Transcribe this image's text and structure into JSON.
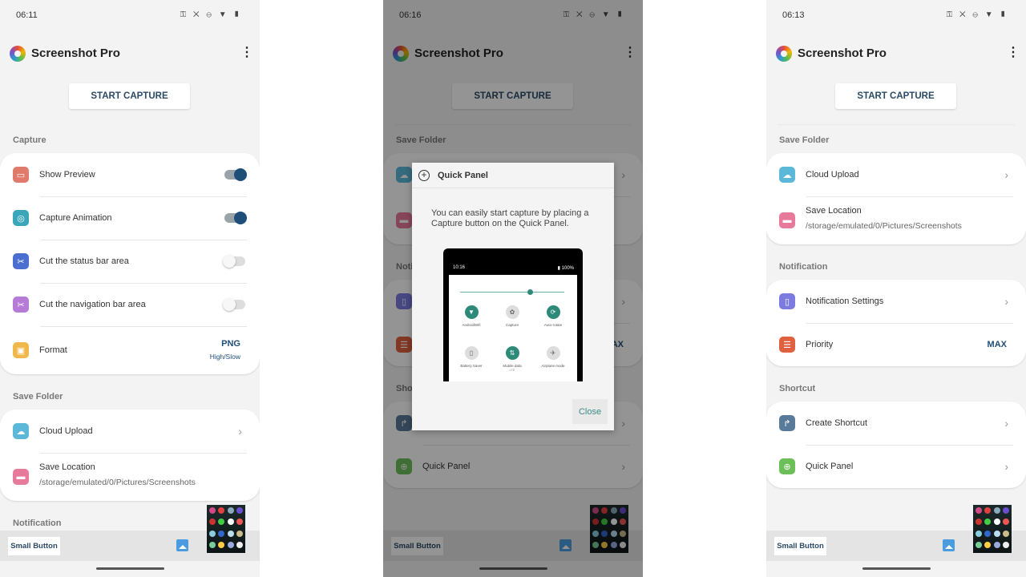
{
  "app": {
    "title": "Screenshot Pro",
    "start_capture": "START CAPTURE",
    "small_button": "Small Button",
    "status_icons": "⚿ ✕ ⊖ ▼ ▮"
  },
  "colors": {
    "accent": "#1f4e79",
    "toggle_on": "#1f4e79",
    "dialog_accent": "#3a8a86"
  },
  "panels": [
    {
      "time": "06:11",
      "scroll_edge": false,
      "sections": [
        {
          "title": "Capture",
          "items": [
            {
              "label": "Show Preview",
              "icon": "preview-icon",
              "icon_color": "#e07a6a",
              "glyph": "▭",
              "control": "toggle",
              "on": true
            },
            {
              "label": "Capture Animation",
              "icon": "animation-icon",
              "icon_color": "#3aa6b9",
              "glyph": "◎",
              "control": "toggle",
              "on": true
            },
            {
              "label": "Cut the status bar area",
              "icon": "scissors-icon",
              "icon_color": "#4a6fd0",
              "glyph": "✂",
              "control": "toggle",
              "on": false
            },
            {
              "label": "Cut the navigation bar area",
              "icon": "scissors-icon",
              "icon_color": "#b57bd6",
              "glyph": "✂",
              "control": "toggle",
              "on": false
            },
            {
              "label": "Format",
              "icon": "save-icon",
              "icon_color": "#f0b84a",
              "glyph": "▣",
              "control": "value",
              "value": "PNG",
              "value_sub": "High/Slow"
            }
          ]
        },
        {
          "title": "Save Folder",
          "items": [
            {
              "label": "Cloud Upload",
              "icon": "cloud-upload-icon",
              "icon_color": "#5bb8d8",
              "glyph": "☁",
              "control": "chevron"
            },
            {
              "label": "Save Location",
              "sub": "/storage/emulated/0/Pictures/Screenshots",
              "icon": "folder-icon",
              "icon_color": "#e7799a",
              "glyph": "▬",
              "control": "none"
            }
          ]
        },
        {
          "title": "Notification",
          "items": []
        }
      ]
    },
    {
      "time": "06:16",
      "scroll_edge": true,
      "dialog": true,
      "sections": [
        {
          "title": "Save Folder",
          "items": [
            {
              "label": "Cloud Upload",
              "icon": "cloud-upload-icon",
              "icon_color": "#5bb8d8",
              "glyph": "☁",
              "control": "chevron"
            },
            {
              "label": "Save Location",
              "sub": "/storage/emulated/0/Pictures/Screenshots",
              "icon": "folder-icon",
              "icon_color": "#e7799a",
              "glyph": "▬",
              "control": "none"
            }
          ]
        },
        {
          "title": "Notification",
          "items": [
            {
              "label": "Notification Settings",
              "icon": "phone-icon",
              "icon_color": "#7b7be0",
              "glyph": "▯",
              "control": "chevron"
            },
            {
              "label": "Priority",
              "icon": "priority-icon",
              "icon_color": "#e0613f",
              "glyph": "☰",
              "control": "value",
              "value": "MAX"
            }
          ]
        },
        {
          "title": "Shortcut",
          "items": [
            {
              "label": "Create Shortcut",
              "icon": "shortcut-arrow-icon",
              "icon_color": "#5a7a9a",
              "glyph": "↱",
              "control": "chevron"
            },
            {
              "label": "Quick Panel",
              "icon": "plus-circle-icon",
              "icon_color": "#6dbf5a",
              "glyph": "⊕",
              "control": "chevron"
            }
          ]
        }
      ]
    },
    {
      "time": "06:13",
      "scroll_edge": true,
      "sections": [
        {
          "title": "Save Folder",
          "items": [
            {
              "label": "Cloud Upload",
              "icon": "cloud-upload-icon",
              "icon_color": "#5bb8d8",
              "glyph": "☁",
              "control": "chevron"
            },
            {
              "label": "Save Location",
              "sub": "/storage/emulated/0/Pictures/Screenshots",
              "icon": "folder-icon",
              "icon_color": "#e7799a",
              "glyph": "▬",
              "control": "none"
            }
          ]
        },
        {
          "title": "Notification",
          "items": [
            {
              "label": "Notification Settings",
              "icon": "phone-icon",
              "icon_color": "#7b7be0",
              "glyph": "▯",
              "control": "chevron"
            },
            {
              "label": "Priority",
              "icon": "priority-icon",
              "icon_color": "#e0613f",
              "glyph": "☰",
              "control": "value",
              "value": "MAX"
            }
          ]
        },
        {
          "title": "Shortcut",
          "items": [
            {
              "label": "Create Shortcut",
              "icon": "shortcut-arrow-icon",
              "icon_color": "#5a7a9a",
              "glyph": "↱",
              "control": "chevron"
            },
            {
              "label": "Quick Panel",
              "icon": "plus-circle-icon",
              "icon_color": "#6dbf5a",
              "glyph": "⊕",
              "control": "chevron"
            }
          ]
        }
      ]
    }
  ],
  "dialog": {
    "title": "Quick Panel",
    "message": "You can easily start capture by placing a Capture button on the Quick Panel.",
    "close": "Close",
    "mock": {
      "time": "10:16",
      "battery": "▮ 100%",
      "tiles": [
        {
          "label": "AndroidWifi",
          "glyph": "▼",
          "active": true
        },
        {
          "label": "Capture",
          "glyph": "✿",
          "active": false
        },
        {
          "label": "Auto-rotate",
          "glyph": "⟳",
          "active": true
        },
        {
          "label": "Battery Saver",
          "glyph": "▯",
          "active": false
        },
        {
          "label": "Mobile data",
          "sub": "LTE",
          "glyph": "⇅",
          "active": true
        },
        {
          "label": "Airplane mode",
          "glyph": "✈",
          "active": false
        }
      ]
    }
  }
}
